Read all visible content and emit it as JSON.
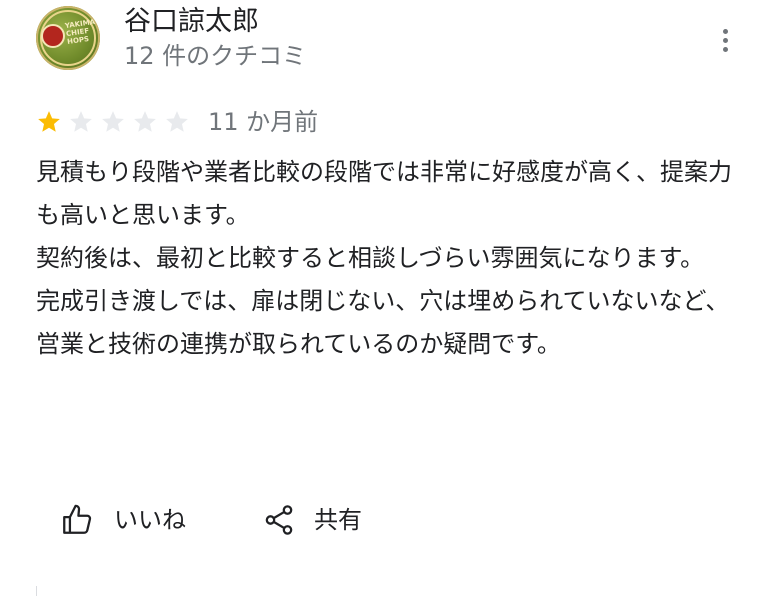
{
  "reviewer": {
    "name": "谷口諒太郎",
    "review_count_label": "12 件のクチコミ",
    "avatar_text": "YAKIMA CHIEF HOPS"
  },
  "rating": {
    "stars_filled": 1,
    "stars_total": 5,
    "time_ago": "11 か月前"
  },
  "review": {
    "text": "見積もり段階や業者比較の段階では非常に好感度が高く、提案力も高いと思います。\n契約後は、最初と比較すると相談しづらい雰囲気になります。\n完成引き渡しでは、扉は閉じない、穴は埋められていないなど、営業と技術の連携が取られているのか疑問です。"
  },
  "actions": {
    "like_label": "いいね",
    "share_label": "共有"
  },
  "icons": {
    "menu": "more-vert-icon",
    "like": "thumb-up-icon",
    "share": "share-icon"
  },
  "colors": {
    "star_filled": "#fbbc04",
    "star_empty": "#e8eaed",
    "secondary_text": "#70757a"
  }
}
